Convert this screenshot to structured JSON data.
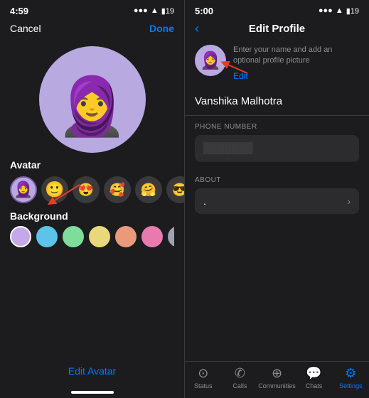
{
  "left": {
    "status_time": "4:59",
    "cancel_label": "Cancel",
    "done_label": "Done",
    "avatar_emoji": "🧕",
    "avatar_label": "Avatar",
    "background_label": "Background",
    "edit_avatar_label": "Edit Avatar",
    "avatars": [
      {
        "emoji": "🧕",
        "selected": true
      },
      {
        "emoji": "🙂",
        "selected": false
      },
      {
        "emoji": "😍",
        "selected": false
      },
      {
        "emoji": "🥰",
        "selected": false
      },
      {
        "emoji": "🤗",
        "selected": false
      },
      {
        "emoji": "😎",
        "selected": false
      }
    ],
    "colors": [
      {
        "hex": "#c4a8e8",
        "selected": true
      },
      {
        "hex": "#5bc4e8",
        "selected": false
      },
      {
        "hex": "#7edd9a",
        "selected": false
      },
      {
        "hex": "#e8d87a",
        "selected": false
      },
      {
        "hex": "#e89a7a",
        "selected": false
      },
      {
        "hex": "#e87ab0",
        "selected": false
      },
      {
        "hex": "#a0a0b0",
        "selected": false
      }
    ]
  },
  "right": {
    "status_time": "5:00",
    "back_icon": "‹",
    "page_title": "Edit Profile",
    "profile_hint": "Enter your name and add an optional profile picture",
    "edit_label": "Edit",
    "name_value": "Vanshika Malhotra",
    "phone_label": "PHONE NUMBER",
    "phone_value": "",
    "about_label": "ABOUT",
    "about_value": ".",
    "tabs": [
      {
        "icon": "○",
        "label": "Status",
        "active": false
      },
      {
        "icon": "✆",
        "label": "Calls",
        "active": false
      },
      {
        "icon": "⊙",
        "label": "Communities",
        "active": false
      },
      {
        "icon": "💬",
        "label": "Chats",
        "active": false
      },
      {
        "icon": "⚙",
        "label": "Settings",
        "active": true
      }
    ]
  }
}
